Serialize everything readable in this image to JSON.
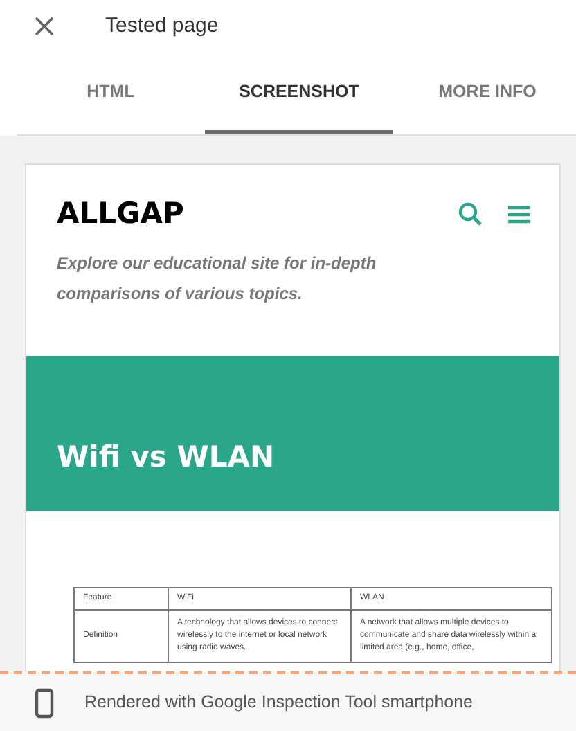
{
  "title": "Tested page",
  "tabs": [
    {
      "label": "HTML",
      "selected": false
    },
    {
      "label": "SCREENSHOT",
      "selected": true
    },
    {
      "label": "MORE INFO",
      "selected": false
    }
  ],
  "preview": {
    "site_name": "ALLGAP",
    "tagline": "Explore our educational site for in-depth comparisons of various topics.",
    "banner_title": "Wifi vs WLAN",
    "table": {
      "columns": [
        "Feature",
        "WiFi",
        "WLAN"
      ],
      "rows": [
        [
          "Definition",
          "A technology that allows devices to connect wirelessly to the internet or local network using radio waves.",
          "A network that allows multiple devices to communicate and share data wirelessly within a limited area (e.g., home, office,"
        ]
      ]
    }
  },
  "footer": {
    "text": "Rendered with Google Inspection Tool smartphone"
  }
}
